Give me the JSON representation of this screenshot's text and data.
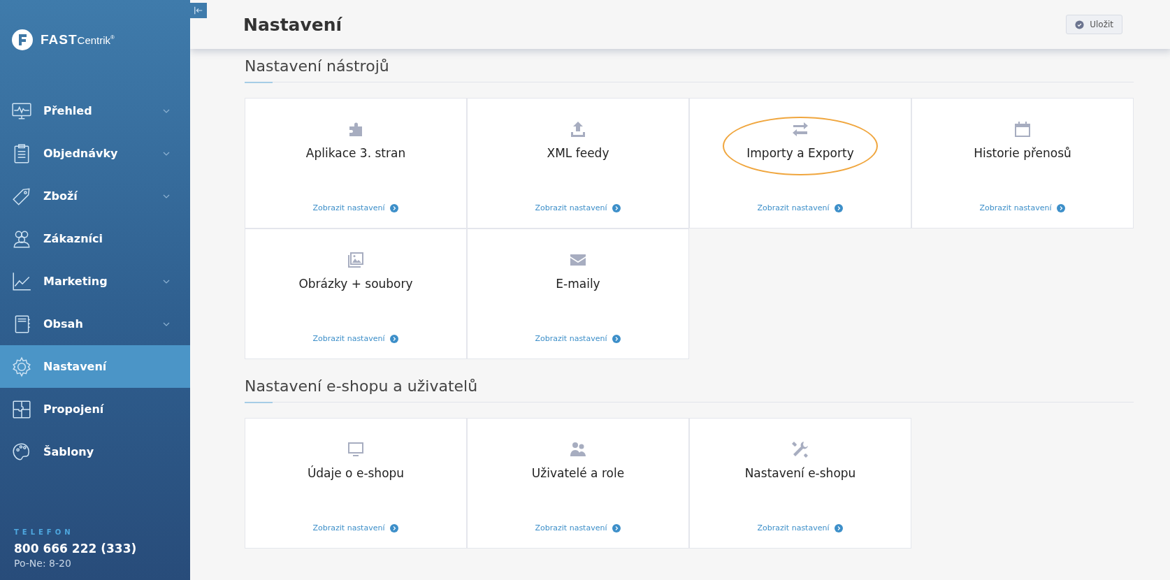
{
  "sidebar": {
    "logo": {
      "brand": "FAST",
      "suffix": "Centrik",
      "mark": "®"
    },
    "items": [
      {
        "label": "Přehled",
        "kind": "monitor",
        "expandable": true,
        "selected": false
      },
      {
        "label": "Objednávky",
        "kind": "clipboard",
        "expandable": true,
        "selected": false
      },
      {
        "label": "Zboží",
        "kind": "tag",
        "expandable": true,
        "selected": false
      },
      {
        "label": "Zákazníci",
        "kind": "people",
        "expandable": false,
        "selected": false
      },
      {
        "label": "Marketing",
        "kind": "chart",
        "expandable": true,
        "selected": false
      },
      {
        "label": "Obsah",
        "kind": "notebook",
        "expandable": true,
        "selected": false
      },
      {
        "label": "Nastavení",
        "kind": "gear",
        "expandable": false,
        "selected": true
      },
      {
        "label": "Propojení",
        "kind": "puzzle",
        "expandable": false,
        "selected": false
      },
      {
        "label": "Šablony",
        "kind": "palette",
        "expandable": false,
        "selected": false
      }
    ],
    "contact": {
      "heading": "TELEFON",
      "phone": "800 666 222 (333)",
      "hours": "Po-Ne: 8-20"
    }
  },
  "header": {
    "title": "Nastavení",
    "save_button": "Uložit"
  },
  "sections": [
    {
      "title": "Nastavení nástrojů",
      "cards": [
        {
          "title": "Aplikace 3. stran",
          "kind": "puzzle",
          "link": "Zobrazit nastavení",
          "highlighted": false
        },
        {
          "title": "XML feedy",
          "kind": "upload",
          "link": "Zobrazit nastavení",
          "highlighted": false
        },
        {
          "title": "Importy a Exporty",
          "kind": "swap",
          "link": "Zobrazit nastavení",
          "highlighted": true
        },
        {
          "title": "Historie přenosů",
          "kind": "calendar",
          "link": "Zobrazit nastavení",
          "highlighted": false
        },
        {
          "title": "Obrázky + soubory",
          "kind": "images",
          "link": "Zobrazit nastavení",
          "highlighted": false
        },
        {
          "title": "E-maily",
          "kind": "envelope",
          "link": "Zobrazit nastavení",
          "highlighted": false
        }
      ]
    },
    {
      "title": "Nastavení e-shopu a uživatelů",
      "cards": [
        {
          "title": "Údaje o e-shopu",
          "kind": "monitor",
          "link": "Zobrazit nastavení",
          "highlighted": false
        },
        {
          "title": "Uživatelé a role",
          "kind": "users",
          "link": "Zobrazit nastavení",
          "highlighted": false
        },
        {
          "title": "Nastavení e-shopu",
          "kind": "tools",
          "link": "Zobrazit nastavení",
          "highlighted": false
        }
      ]
    }
  ]
}
